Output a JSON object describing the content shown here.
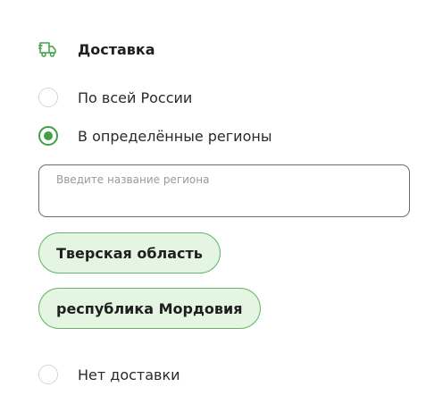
{
  "delivery": {
    "title": "Доставка",
    "icon": "truck-icon",
    "accent_color": "#43a047",
    "options": [
      {
        "label": "По всей России",
        "checked": false
      },
      {
        "label": "В определённые регионы",
        "checked": true
      },
      {
        "label": "Нет доставки",
        "checked": false
      }
    ],
    "region_search": {
      "placeholder": "Введите название региона",
      "value": ""
    },
    "selected_regions": [
      {
        "label": "Тверская область"
      },
      {
        "label": "республика Мордовия"
      }
    ]
  }
}
